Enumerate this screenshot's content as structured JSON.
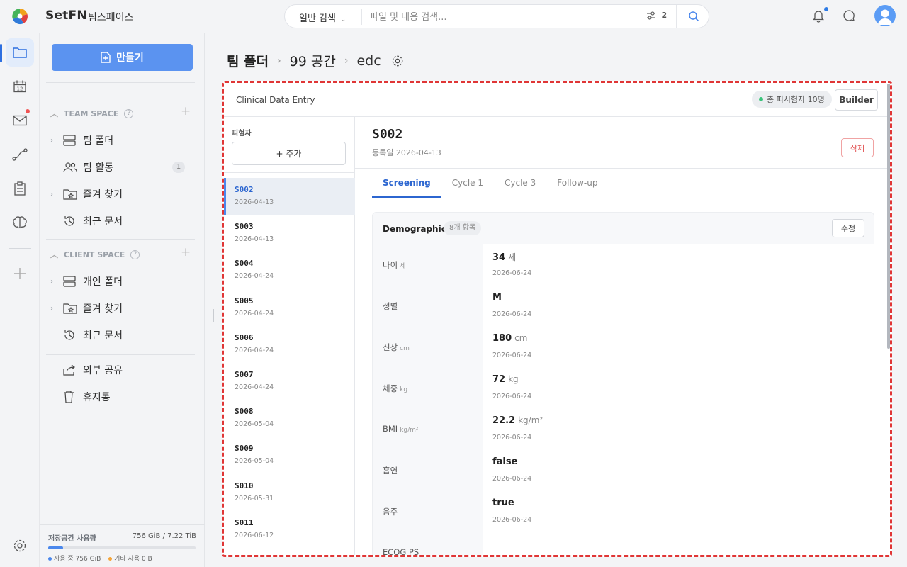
{
  "app": {
    "brand": "SetFN",
    "workspace": "팀스페이스"
  },
  "search": {
    "mode": "일반 검색",
    "placeholder": "파일 및 내용 검색...",
    "filter_count": "2"
  },
  "sidebar": {
    "create_label": "만들기",
    "team_space": {
      "title": "TEAM SPACE",
      "items": [
        {
          "label": "팀 폴더"
        },
        {
          "label": "팀 활동",
          "badge": "1"
        },
        {
          "label": "즐겨 찾기"
        },
        {
          "label": "최근 문서"
        }
      ]
    },
    "client_space": {
      "title": "CLIENT SPACE",
      "items": [
        {
          "label": "개인 폴더"
        },
        {
          "label": "즐겨 찾기"
        },
        {
          "label": "최근 문서"
        }
      ]
    },
    "share_label": "외부 공유",
    "trash_label": "휴지통",
    "storage": {
      "label": "저장공간 사용량",
      "value": "756 GiB / 7.22 TiB",
      "used_fraction": 0.1,
      "used_legend": "사용 중 756 GiB",
      "other_legend": "기타 사용 0 B",
      "used_color": "#4a87ec",
      "other_color": "#f5a53a"
    }
  },
  "breadcrumb": {
    "root": "팀 폴더",
    "mid": "99 공간",
    "current": "edc"
  },
  "edc": {
    "title": "Clinical Data Entry",
    "total_pill": "총 피시험자 10명",
    "builder_label": "Builder",
    "subjects_label": "피험자",
    "add_label": "+ 추가",
    "subjects": [
      {
        "id": "S002",
        "date": "2026-04-13"
      },
      {
        "id": "S003",
        "date": "2026-04-13"
      },
      {
        "id": "S004",
        "date": "2026-04-24"
      },
      {
        "id": "S005",
        "date": "2026-04-24"
      },
      {
        "id": "S006",
        "date": "2026-04-24"
      },
      {
        "id": "S007",
        "date": "2026-04-24"
      },
      {
        "id": "S008",
        "date": "2026-05-04"
      },
      {
        "id": "S009",
        "date": "2026-05-04"
      },
      {
        "id": "S010",
        "date": "2026-05-31"
      },
      {
        "id": "S011",
        "date": "2026-06-12"
      }
    ],
    "detail": {
      "id": "S002",
      "registered": "등록일 2026-04-13",
      "delete_label": "삭제",
      "tabs": [
        "Screening",
        "Cycle 1",
        "Cycle 3",
        "Follow-up"
      ],
      "section": {
        "title": "Demographics",
        "count": "8개 항목",
        "edit_label": "수정",
        "fields": [
          {
            "label": "나이",
            "unit": "세",
            "value": "34",
            "value_unit": "세",
            "date": "2026-06-24"
          },
          {
            "label": "성별",
            "unit": "",
            "value": "M",
            "value_unit": "",
            "date": "2026-06-24"
          },
          {
            "label": "신장",
            "unit": "cm",
            "value": "180",
            "value_unit": "cm",
            "date": "2026-06-24"
          },
          {
            "label": "체중",
            "unit": "kg",
            "value": "72",
            "value_unit": "kg",
            "date": "2026-06-24"
          },
          {
            "label": "BMI",
            "unit": "kg/m²",
            "value": "22.2",
            "value_unit": "kg/m²",
            "date": "2026-06-24"
          },
          {
            "label": "흡연",
            "unit": "",
            "value": "false",
            "value_unit": "",
            "date": "2026-06-24"
          },
          {
            "label": "음주",
            "unit": "",
            "value": "true",
            "value_unit": "",
            "date": "2026-06-24"
          },
          {
            "label": "ECOG PS",
            "unit": "",
            "value": "",
            "value_unit": "",
            "date": "",
            "empty": "—"
          }
        ]
      }
    }
  }
}
